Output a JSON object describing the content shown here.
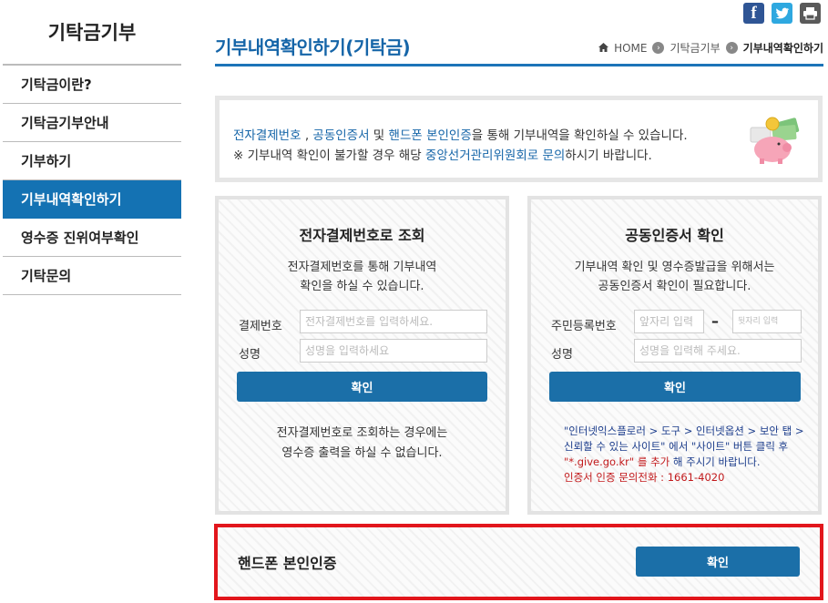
{
  "sidebar": {
    "title": "기탁금기부",
    "items": [
      {
        "label": "기탁금이란?",
        "active": false
      },
      {
        "label": "기탁금기부안내",
        "active": false
      },
      {
        "label": "기부하기",
        "active": false
      },
      {
        "label": "기부내역확인하기",
        "active": true
      },
      {
        "label": "영수증 진위여부확인",
        "active": false
      },
      {
        "label": "기탁문의",
        "active": false
      }
    ]
  },
  "social": {
    "facebook": "f",
    "twitter": "twitter-icon",
    "print": "print-icon"
  },
  "header": {
    "title": "기부내역확인하기(기탁금)",
    "breadcrumb": [
      "HOME",
      "기탁금기부",
      "기부내역확인하기"
    ]
  },
  "info": {
    "line1_parts": [
      "전자결제번호",
      " , ",
      "공동인증서",
      " 및 ",
      "핸드폰 본인인증",
      "을 통해 기부내역을 확인하실 수 있습니다."
    ],
    "line2_prefix": "※ 기부내역 확인이 불가할 경우 해당 ",
    "line2_link": "중앙선거관리위원회로 문의",
    "line2_suffix": "하시기 바랍니다."
  },
  "payment_panel": {
    "title": "전자결제번호로 조회",
    "desc_line1": "전자결제번호를 통해 기부내역",
    "desc_line2": "확인을 하실 수 있습니다.",
    "field1_label": "결제번호",
    "field1_placeholder": "전자결제번호를 입력하세요.",
    "field2_label": "성명",
    "field2_placeholder": "성명을 입력하세요",
    "button": "확인",
    "note_line1": "전자결제번호로 조회하는 경우에는",
    "note_line2": "영수증 출력을 하실 수 없습니다."
  },
  "cert_panel": {
    "title": "공동인증서 확인",
    "desc_line1": "기부내역 확인 및 영수증발급을 위해서는",
    "desc_line2": "공동인증서 확인이 필요합니다.",
    "field1_label": "주민등록번호",
    "field1a_placeholder": "앞자리 입력",
    "field1b_placeholder": "뒷자리 입력",
    "field2_label": "성명",
    "field2_placeholder": "성명을 입력해 주세요.",
    "button": "확인",
    "help_line1": "\"인터넷익스플로러 > 도구 > 인터넷옵션 > 보안 탭 >",
    "help_line2": "신뢰할 수 있는 사이트\" 에서 \"사이트\" 버튼 클릭 후",
    "help_line3_red": "\"*.give.go.kr\" 를 추가",
    "help_line3_rest": " 해 주시기 바랍니다.",
    "help_line4": "인증서 인증 문의전화 : 1661-4020"
  },
  "phone_panel": {
    "title": "핸드폰 본인인증",
    "button": "확인"
  },
  "colors": {
    "accent": "#1472b3",
    "button": "#1b6fa8",
    "highlight_border": "#e2161c"
  }
}
